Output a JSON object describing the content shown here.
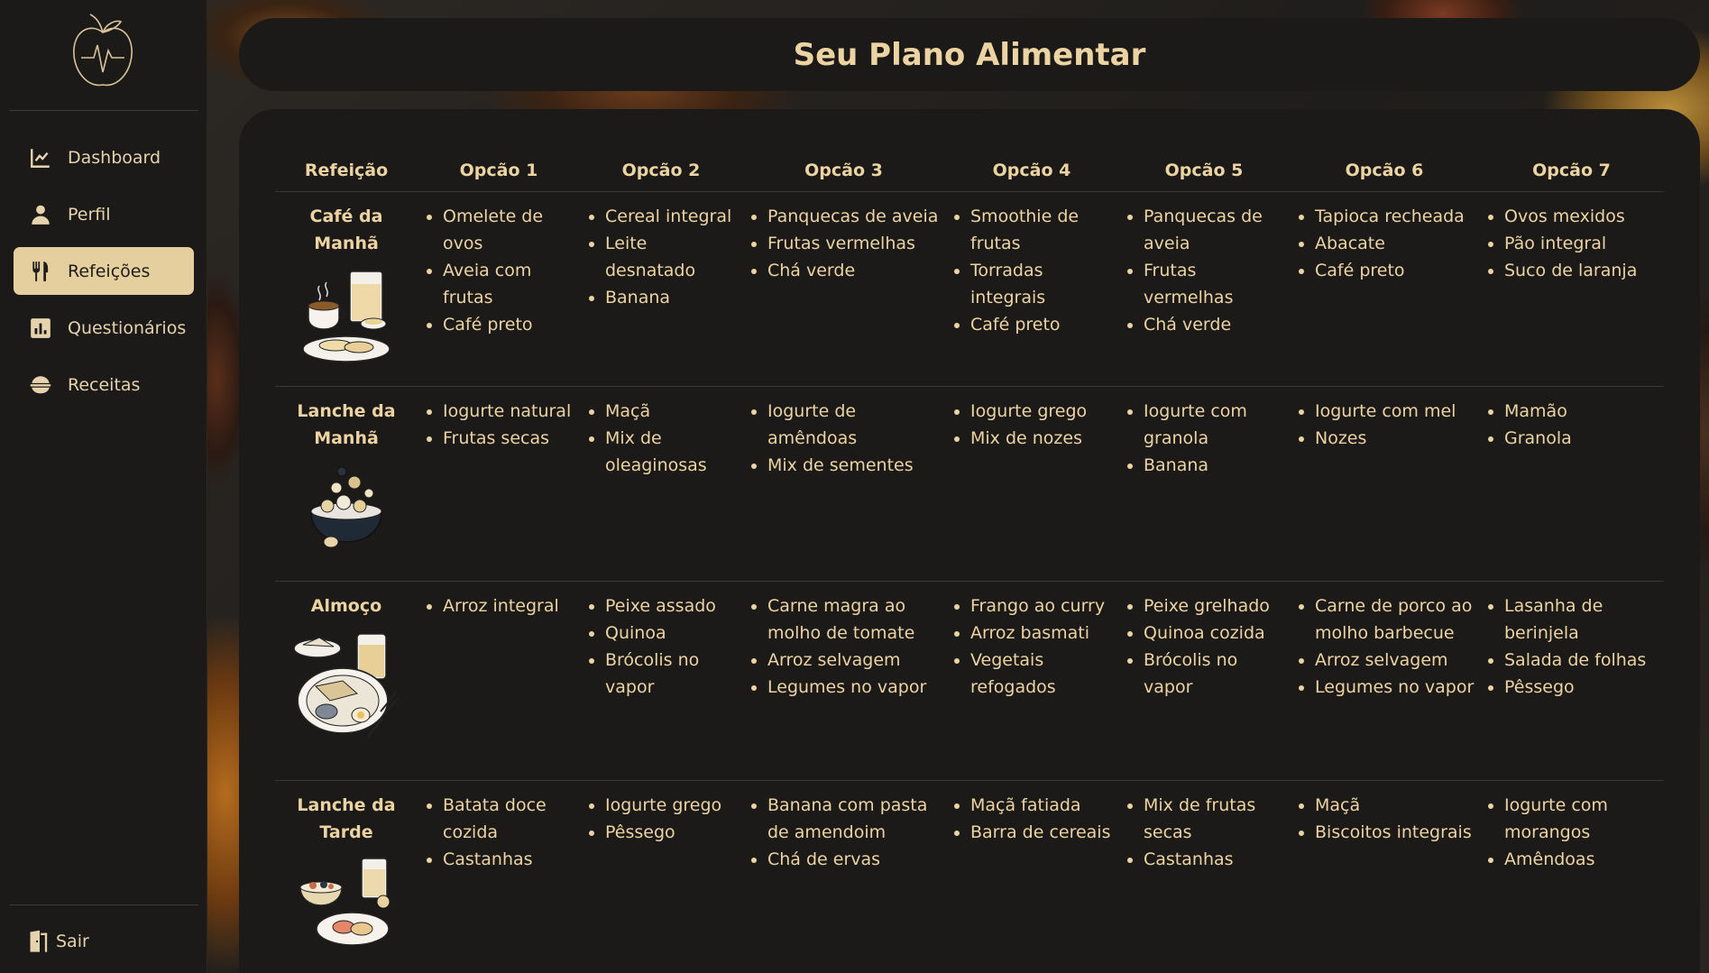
{
  "sidebar": {
    "items": [
      {
        "label": "Dashboard",
        "icon": "chart-line-icon",
        "active": false
      },
      {
        "label": "Perfil",
        "icon": "user-icon",
        "active": false
      },
      {
        "label": "Refeições",
        "icon": "utensils-icon",
        "active": true
      },
      {
        "label": "Questionários",
        "icon": "bar-chart-icon",
        "active": false
      },
      {
        "label": "Receitas",
        "icon": "bowl-icon",
        "active": false
      }
    ],
    "logout_label": "Sair"
  },
  "header": {
    "title": "Seu Plano Alimentar"
  },
  "table": {
    "headers": [
      "Refeição",
      "Opcão 1",
      "Opcão 2",
      "Opcão 3",
      "Opcão 4",
      "Opcão 5",
      "Opcão 6",
      "Opcão 7"
    ],
    "rows": [
      {
        "meal": "Café da Manhã",
        "options": [
          [
            "Omelete de ovos",
            "Aveia com frutas",
            "Café preto"
          ],
          [
            "Cereal integral",
            "Leite desnatado",
            "Banana"
          ],
          [
            "Panquecas de aveia",
            "Frutas vermelhas",
            "Chá verde"
          ],
          [
            "Smoothie de frutas",
            "Torradas integrais",
            "Café preto"
          ],
          [
            "Panquecas de aveia",
            "Frutas vermelhas",
            "Chá verde"
          ],
          [
            "Tapioca recheada",
            "Abacate",
            "Café preto"
          ],
          [
            "Ovos mexidos",
            "Pão integral",
            "Suco de laranja"
          ]
        ]
      },
      {
        "meal": "Lanche da Manhã",
        "options": [
          [
            "Iogurte natural",
            "Frutas secas"
          ],
          [
            "Maçã",
            "Mix de oleaginosas"
          ],
          [
            "Iogurte de amêndoas",
            "Mix de sementes"
          ],
          [
            "Iogurte grego",
            "Mix de nozes"
          ],
          [
            "Iogurte com granola",
            "Banana"
          ],
          [
            "Iogurte com mel",
            "Nozes"
          ],
          [
            "Mamão",
            "Granola"
          ]
        ]
      },
      {
        "meal": "Almoço",
        "options": [
          [
            "Arroz integral"
          ],
          [
            "Peixe assado",
            "Quinoa",
            "Brócolis no vapor"
          ],
          [
            "Carne magra ao molho de tomate",
            "Arroz selvagem",
            "Legumes no vapor"
          ],
          [
            "Frango ao curry",
            "Arroz basmati",
            "Vegetais refogados"
          ],
          [
            "Peixe grelhado",
            "Quinoa cozida",
            "Brócolis no vapor"
          ],
          [
            "Carne de porco ao molho barbecue",
            "Arroz selvagem",
            "Legumes no vapor"
          ],
          [
            "Lasanha de berinjela",
            "Salada de folhas",
            "Pêssego"
          ]
        ]
      },
      {
        "meal": "Lanche da Tarde",
        "options": [
          [
            "Batata doce cozida",
            "Castanhas"
          ],
          [
            "Iogurte grego",
            "Pêssego"
          ],
          [
            "Banana com pasta de amendoim",
            "Chá de ervas"
          ],
          [
            "Maçã fatiada",
            "Barra de cereais"
          ],
          [
            "Mix de frutas secas",
            "Castanhas"
          ],
          [
            "Maçã",
            "Biscoitos integrais"
          ],
          [
            "Iogurte com morangos",
            "Amêndoas"
          ]
        ]
      }
    ]
  },
  "colors": {
    "accent": "#e6cf9e",
    "text": "#ecd3a2",
    "panel": "#1c1a18",
    "sidebar": "#1b1a18"
  }
}
